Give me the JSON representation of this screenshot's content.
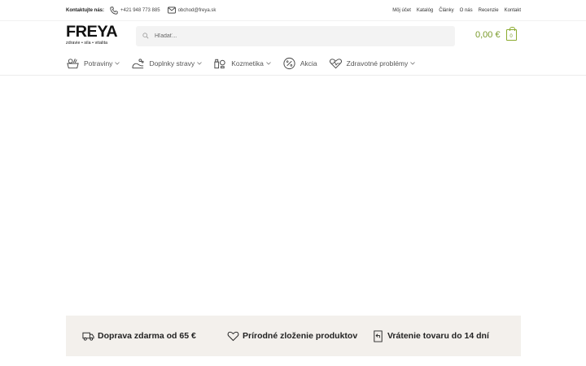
{
  "topbar": {
    "contact_label": "Kontaktujte nás:",
    "phone": "+421 948 773 885",
    "email": "obchod@freya.sk",
    "links": [
      "Môj účet",
      "Katalóg",
      "Články",
      "O nás",
      "Recenzie",
      "Kontakt"
    ]
  },
  "logo": {
    "brand": "FREYA",
    "tagline": "zdravie • sila • vitalita"
  },
  "search": {
    "placeholder": "Hľadať..."
  },
  "cart": {
    "total": "0,00 €",
    "count": "0"
  },
  "nav": {
    "items": [
      {
        "label": "Potraviny",
        "icon": "groceries-icon",
        "has_dropdown": true
      },
      {
        "label": "Doplnky stravy",
        "icon": "supplements-icon",
        "has_dropdown": true
      },
      {
        "label": "Kozmetika",
        "icon": "cosmetics-icon",
        "has_dropdown": true
      },
      {
        "label": "Akcia",
        "icon": "sale-icon",
        "has_dropdown": false
      },
      {
        "label": "Zdravotné problémy",
        "icon": "heartbeat-icon",
        "has_dropdown": true
      }
    ]
  },
  "benefits": [
    {
      "label": "Doprava zdarma od 65 €",
      "icon": "truck-icon"
    },
    {
      "label": "Prírodné zloženie produktov",
      "icon": "heart-icon"
    },
    {
      "label": "Vrátenie tovaru do 14 dní",
      "icon": "return-icon"
    }
  ],
  "colors": {
    "accent": "#7a9a2a",
    "benefit_bar": "#f3f0ec",
    "search_bg": "#f3f3f3"
  }
}
